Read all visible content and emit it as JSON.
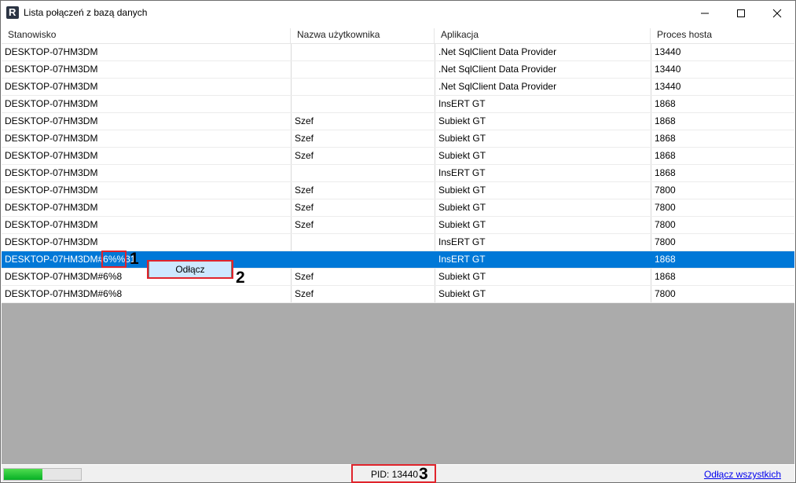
{
  "window": {
    "title": "Lista połączeń z bazą danych",
    "app_icon_letter": "R"
  },
  "columns": [
    "Stanowisko",
    "Nazwa użytkownika",
    "Aplikacja",
    "Proces hosta"
  ],
  "rows": [
    {
      "workstation": "DESKTOP-07HM3DM",
      "user": "",
      "app": ".Net SqlClient Data Provider",
      "pid": "13440",
      "selected": false
    },
    {
      "workstation": "DESKTOP-07HM3DM",
      "user": "",
      "app": ".Net SqlClient Data Provider",
      "pid": "13440",
      "selected": false
    },
    {
      "workstation": "DESKTOP-07HM3DM",
      "user": "",
      "app": ".Net SqlClient Data Provider",
      "pid": "13440",
      "selected": false
    },
    {
      "workstation": "DESKTOP-07HM3DM",
      "user": "",
      "app": "InsERT GT",
      "pid": "1868",
      "selected": false
    },
    {
      "workstation": "DESKTOP-07HM3DM",
      "user": "Szef",
      "app": "Subiekt GT",
      "pid": "1868",
      "selected": false
    },
    {
      "workstation": "DESKTOP-07HM3DM",
      "user": "Szef",
      "app": "Subiekt GT",
      "pid": "1868",
      "selected": false
    },
    {
      "workstation": "DESKTOP-07HM3DM",
      "user": "Szef",
      "app": "Subiekt GT",
      "pid": "1868",
      "selected": false
    },
    {
      "workstation": "DESKTOP-07HM3DM",
      "user": "",
      "app": "InsERT GT",
      "pid": "1868",
      "selected": false
    },
    {
      "workstation": "DESKTOP-07HM3DM",
      "user": "Szef",
      "app": "Subiekt GT",
      "pid": "7800",
      "selected": false
    },
    {
      "workstation": "DESKTOP-07HM3DM",
      "user": "Szef",
      "app": "Subiekt GT",
      "pid": "7800",
      "selected": false
    },
    {
      "workstation": "DESKTOP-07HM3DM",
      "user": "Szef",
      "app": "Subiekt GT",
      "pid": "7800",
      "selected": false
    },
    {
      "workstation": "DESKTOP-07HM3DM",
      "user": "",
      "app": "InsERT GT",
      "pid": "7800",
      "selected": false
    },
    {
      "workstation": "DESKTOP-07HM3DM#6%%31",
      "user": "",
      "app": "InsERT GT",
      "pid": "1868",
      "selected": true
    },
    {
      "workstation": "DESKTOP-07HM3DM#6%8",
      "user": "Szef",
      "app": "Subiekt GT",
      "pid": "1868",
      "selected": false
    },
    {
      "workstation": "DESKTOP-07HM3DM#6%8",
      "user": "Szef",
      "app": "Subiekt GT",
      "pid": "7800",
      "selected": false
    }
  ],
  "context_menu": {
    "item": "Odłącz"
  },
  "annotations": [
    "1",
    "2",
    "3"
  ],
  "status": {
    "pid_text": "PID: 13440",
    "progress_fraction": 0.5,
    "disconnect_all_link": "Odłącz wszystkich"
  },
  "colors": {
    "selection": "#0078d7",
    "annotation_red": "#e0242c",
    "progress_green": "#06b025",
    "empty_area": "#ababab"
  }
}
